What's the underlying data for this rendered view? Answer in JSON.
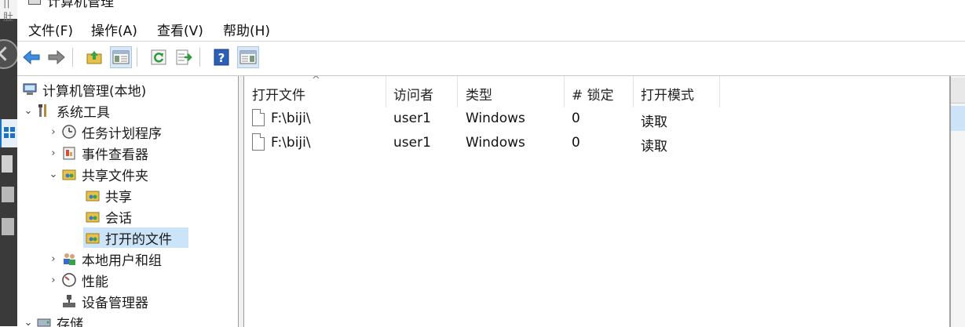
{
  "window": {
    "title": "计算机管理"
  },
  "menu": [
    "文件(F)",
    "操作(A)",
    "查看(V)",
    "帮助(H)"
  ],
  "toolbar": {
    "buttons": [
      "back-icon",
      "forward-icon",
      "up-folder-icon",
      "show-hide-tree-icon",
      "refresh-icon",
      "export-list-icon",
      "help-icon",
      "show-hide-action-pane-icon"
    ]
  },
  "tree": {
    "items": [
      {
        "label": "计算机管理(本地)",
        "icon": "computer-management-icon"
      },
      {
        "label": "系统工具",
        "icon": "system-tools-icon",
        "chevron": "⌄"
      },
      {
        "label": "任务计划程序",
        "icon": "clock-icon",
        "chevron": "›"
      },
      {
        "label": "事件查看器",
        "icon": "event-viewer-icon",
        "chevron": "›"
      },
      {
        "label": "共享文件夹",
        "icon": "shared-folder-icon",
        "chevron": "⌄"
      },
      {
        "label": "共享",
        "icon": "shares-icon"
      },
      {
        "label": "会话",
        "icon": "sessions-icon"
      },
      {
        "label": "打开的文件",
        "icon": "open-files-icon",
        "selected": true
      },
      {
        "label": "本地用户和组",
        "icon": "users-icon",
        "chevron": "›"
      },
      {
        "label": "性能",
        "icon": "performance-icon",
        "chevron": "›"
      },
      {
        "label": "设备管理器",
        "icon": "device-manager-icon"
      },
      {
        "label": "存储",
        "icon": "storage-icon",
        "chevron": "⌄"
      }
    ]
  },
  "list": {
    "columns": [
      "打开文件",
      "访问者",
      "类型",
      "# 锁定",
      "打开模式"
    ],
    "sort_indicator": "^",
    "rows": [
      [
        "F:\\biji\\",
        "user1",
        "Windows",
        "0",
        "读取"
      ],
      [
        "F:\\biji\\",
        "user1",
        "Windows",
        "0",
        "读取"
      ]
    ]
  },
  "background": {
    "top_text": "|| 肚"
  },
  "colors": {
    "selection": "#cce4f7",
    "accent": "#1a73c8"
  }
}
